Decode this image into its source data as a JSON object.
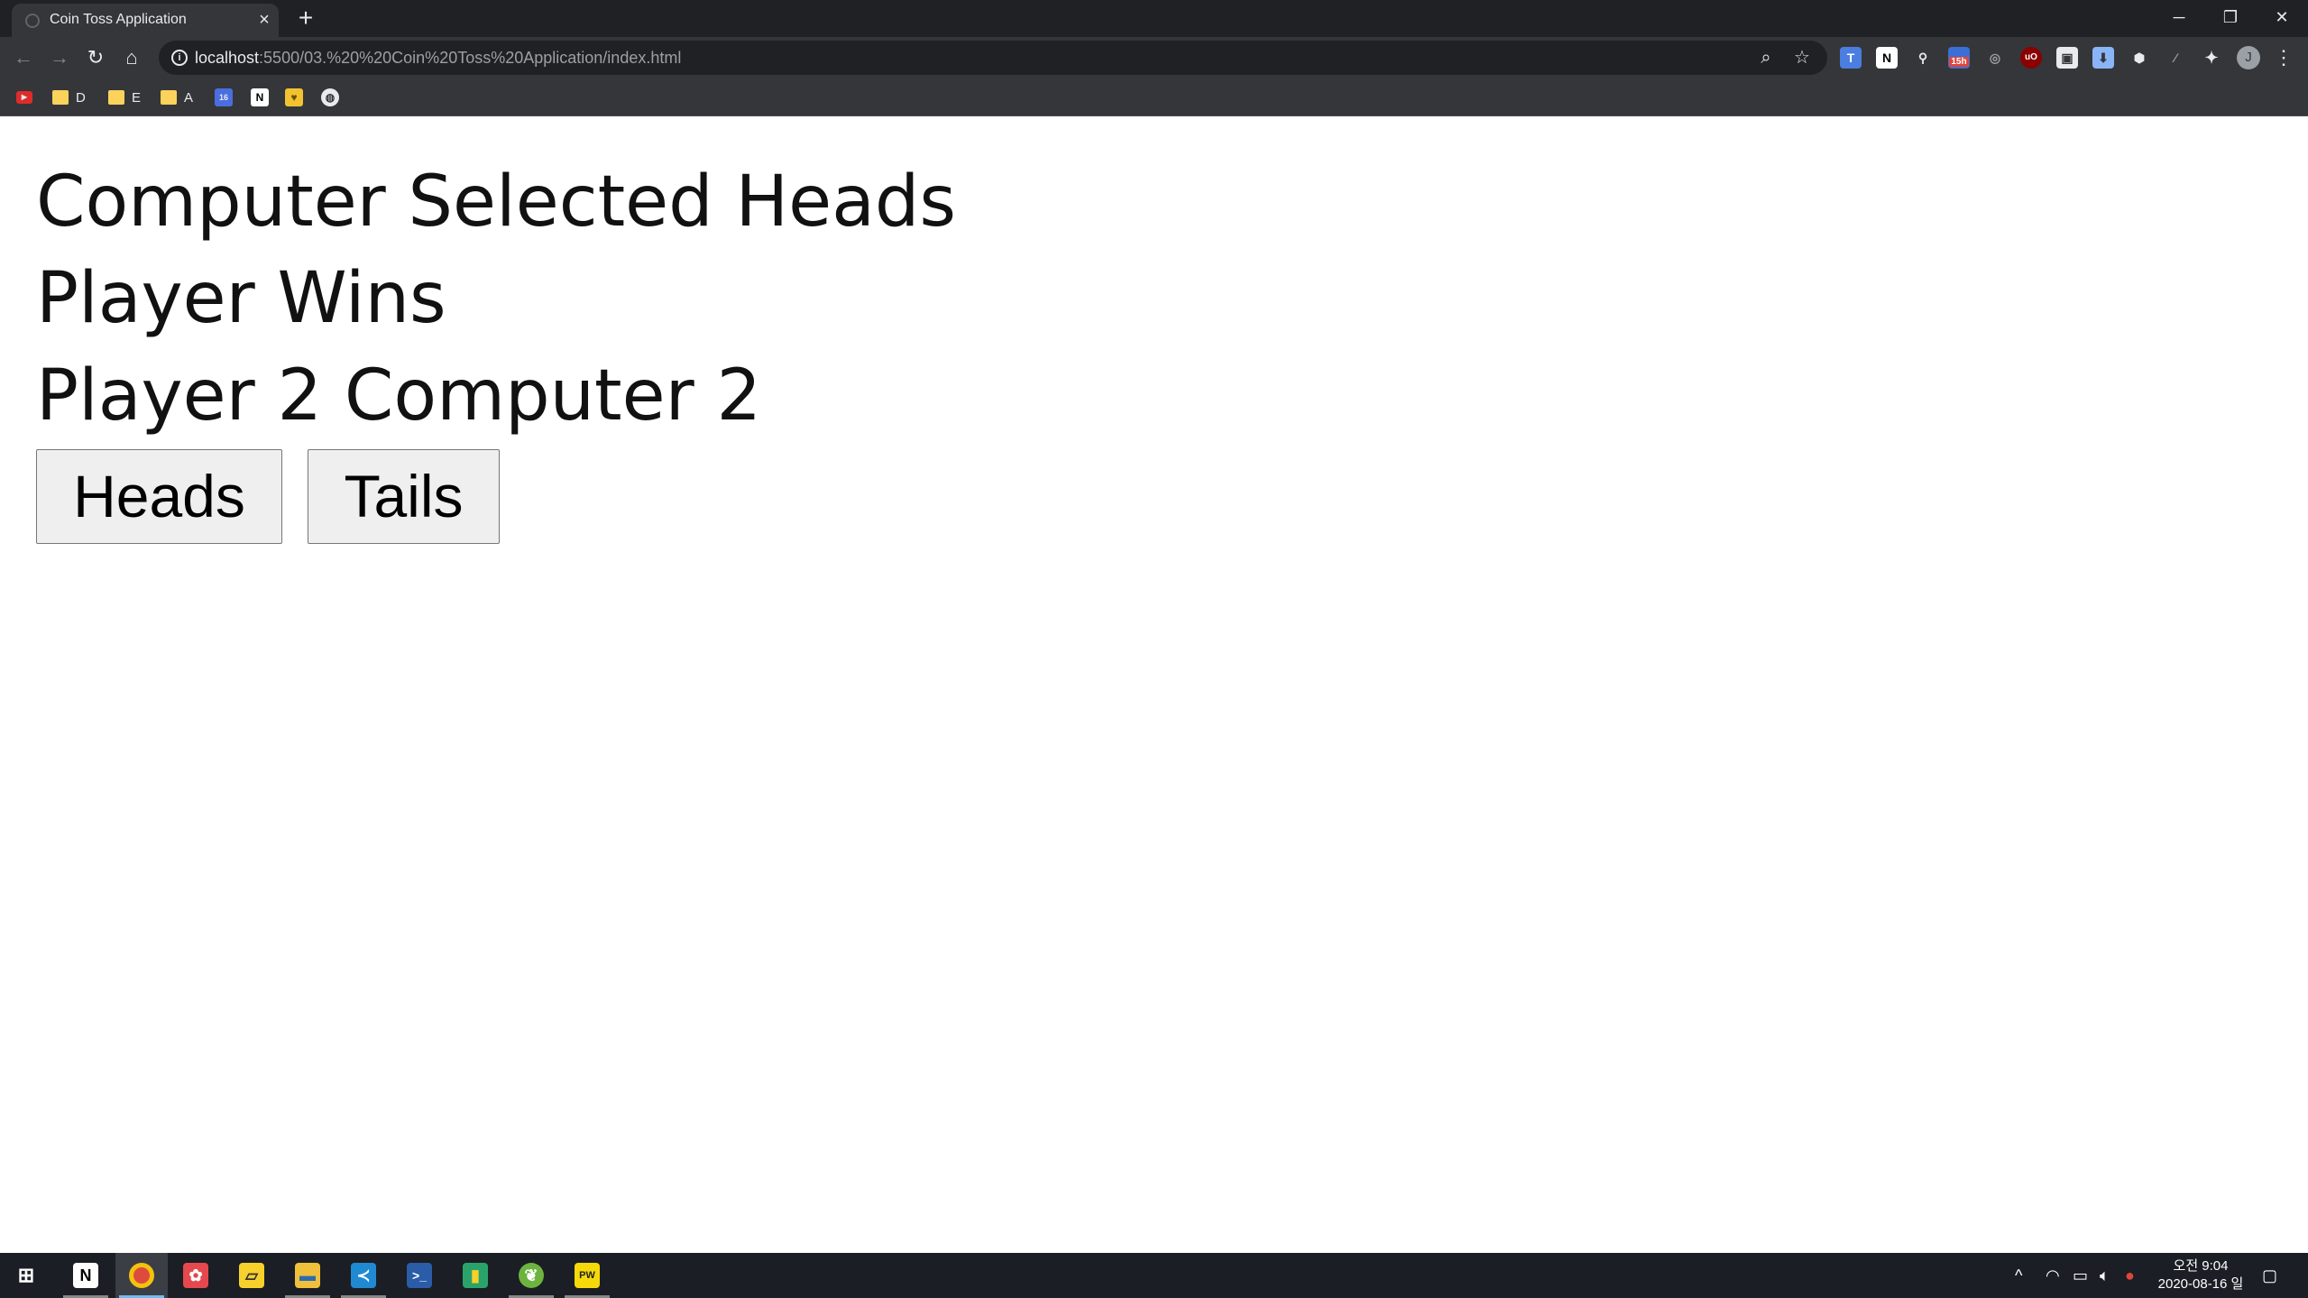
{
  "browser": {
    "tab_title": "Coin Toss Application",
    "tab_close": "×",
    "new_tab": "+",
    "url_host": "localhost",
    "url_path": ":5500/03.%20%20Coin%20Toss%20Application/index.html",
    "bookmarks": [
      {
        "label": "",
        "icon": "youtube-icon"
      },
      {
        "label": "D",
        "icon": "folder-icon"
      },
      {
        "label": "E",
        "icon": "folder-icon"
      },
      {
        "label": "A",
        "icon": "folder-icon"
      },
      {
        "label": "",
        "icon": "calendar-icon"
      },
      {
        "label": "",
        "icon": "notion-icon"
      },
      {
        "label": "",
        "icon": "bookmark-icon"
      },
      {
        "label": "",
        "icon": "globe-icon"
      }
    ],
    "extension_badge": "15h",
    "profile_initial": "J"
  },
  "page": {
    "result_line": "Computer Selected Heads",
    "winner_line": "Player Wins",
    "score_line": "Player 2 Computer 2",
    "heads_label": "Heads",
    "tails_label": "Tails"
  },
  "taskbar": {
    "clock_time": "오전 9:04",
    "clock_date": "2020-08-16 일"
  }
}
